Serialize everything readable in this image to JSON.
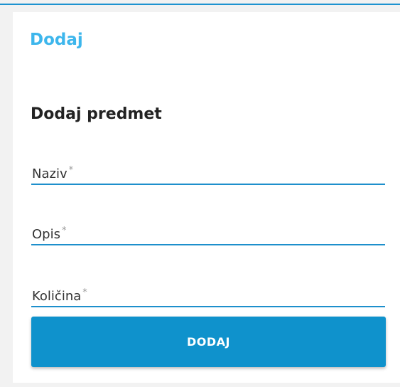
{
  "card": {
    "title": "Dodaj"
  },
  "form": {
    "heading": "Dodaj predmet",
    "required_marker": "*",
    "fields": [
      {
        "label": "Naziv",
        "value": "",
        "required": true
      },
      {
        "label": "Opis",
        "value": "",
        "required": true
      },
      {
        "label": "Količina",
        "value": "",
        "required": true
      }
    ],
    "submit_label": "DODAJ"
  },
  "colors": {
    "accent": "#1d93d0",
    "title": "#3db6ec",
    "button": "#0f92cc",
    "page_background": "#f2f2f2"
  }
}
